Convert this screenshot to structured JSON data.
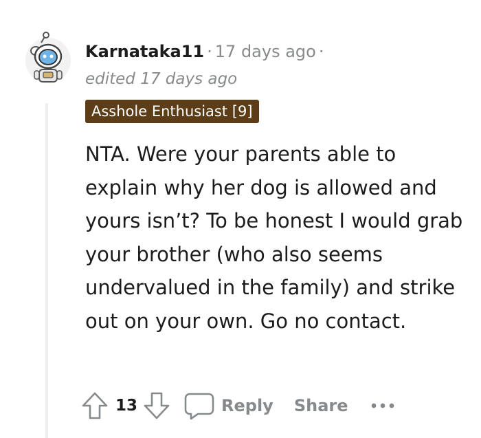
{
  "comment": {
    "author": "Karnataka11",
    "separator": "·",
    "timestamp": "17 days ago",
    "edited": "edited 17 days ago",
    "flair": "Asshole Enthusiast [9]",
    "body": "NTA. Were your parents able to explain why her dog is allowed and yours isn’t? To be honest I would grab your brother (who also seems undervalued in the family) and strike out on your own. Go no contact.",
    "avatar_icon": "snoo-astronaut-avatar"
  },
  "actions": {
    "upvote_icon": "upvote-arrow-icon",
    "vote_count": "13",
    "downvote_icon": "downvote-arrow-icon",
    "reply_icon": "speech-bubble-icon",
    "reply_label": "Reply",
    "share_label": "Share",
    "more_icon": "ellipsis-icon"
  },
  "colors": {
    "flair_bg": "#5c3d17",
    "muted_text": "#878a8c",
    "thread_line": "#edeff1"
  }
}
